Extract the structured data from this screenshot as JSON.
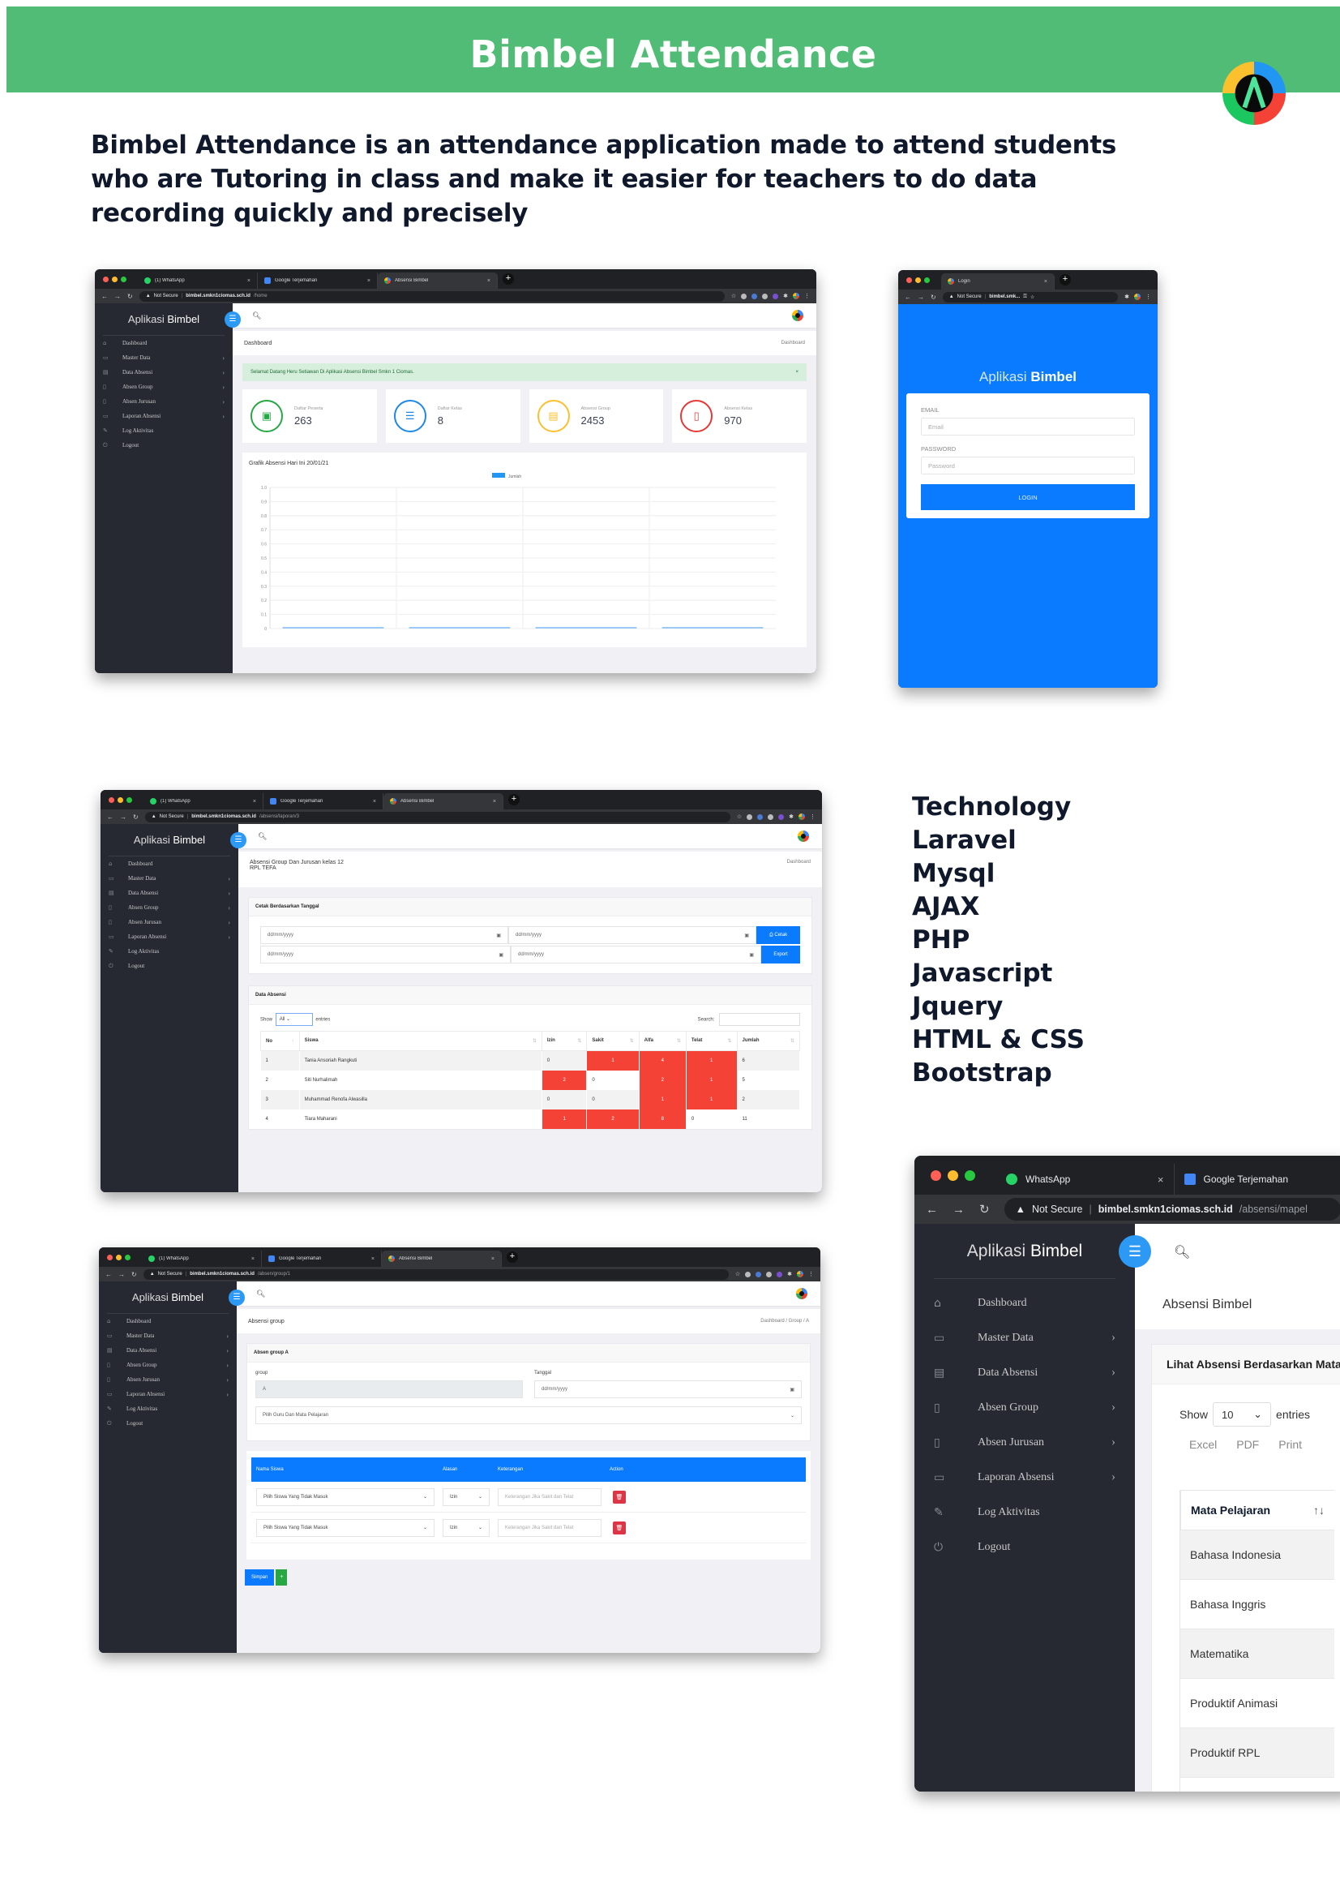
{
  "banner": {
    "title": "Bimbel Attendance"
  },
  "intro": "Bimbel Attendance is an attendance application made to attend students who are Tutoring in class and make it easier for teachers to do data recording quickly and precisely",
  "technology": {
    "heading": "Technology",
    "items": [
      "Laravel",
      "Mysql",
      "AJAX",
      "PHP",
      "Javascript",
      "Jquery",
      "HTML & CSS",
      "Bootstrap"
    ]
  },
  "colors": {
    "banner": "#50bc75",
    "primary": "#0a7bff",
    "danger": "#f44336",
    "sidebar": "#262932"
  },
  "browser": {
    "tabs": [
      "(1) WhatsApp",
      "Google Terjemahan",
      "Absensi Bimbel"
    ],
    "not_secure": "Not Secure",
    "host": "bimbel.smkn1ciomas.sch.id"
  },
  "app": {
    "brand_light": "Aplikasi",
    "brand_bold": "Bimbel",
    "sidebar": [
      {
        "label": "Dashboard",
        "icon": "home-icon",
        "glyph": "⌂",
        "chev": false
      },
      {
        "label": "Master Data",
        "icon": "layout-icon",
        "glyph": "▭",
        "chev": true
      },
      {
        "label": "Data Absensi",
        "icon": "calendar-icon",
        "glyph": "▤",
        "chev": true
      },
      {
        "label": "Absen Group",
        "icon": "notebook-icon",
        "glyph": "▯",
        "chev": true
      },
      {
        "label": "Absen Jurusan",
        "icon": "document-icon",
        "glyph": "▯",
        "chev": true
      },
      {
        "label": "Laporan Absensi",
        "icon": "folder-icon",
        "glyph": "▭",
        "chev": true
      },
      {
        "label": "Log Aktivitas",
        "icon": "edit-icon",
        "glyph": "✎",
        "chev": false
      },
      {
        "label": "Logout",
        "icon": "power-icon",
        "glyph": "⏻",
        "chev": false
      }
    ]
  },
  "dashboard": {
    "url_path": "/home",
    "page_title": "Dashboard",
    "breadcrumb": "Dashboard",
    "alert": "Selamat Datang Heru Setiawan Di Aplikasi Absensi Bimbel Smkn 1 Ciomas.",
    "alert_close": "×",
    "stats": [
      {
        "label": "Daftar Peserta",
        "value": "263",
        "color": "#28a745",
        "glyph": "▣"
      },
      {
        "label": "Daftar Kelas",
        "value": "8",
        "color": "#1e88e5",
        "glyph": "☰"
      },
      {
        "label": "Absensi Group",
        "value": "2453",
        "color": "#fbc02d",
        "glyph": "▤"
      },
      {
        "label": "Absensi Kelas",
        "value": "970",
        "color": "#e53935",
        "glyph": "▯"
      }
    ],
    "chart_title": "Grafik Absensi Hari Ini 20/01/21"
  },
  "chart_data": {
    "type": "bar",
    "title": "Grafik Absensi Hari Ini 20/01/21",
    "legend": [
      "Jumlah"
    ],
    "legend_position": "top",
    "categories": [
      "",
      "",
      "",
      ""
    ],
    "series": [
      {
        "name": "Jumlah",
        "values": [
          0,
          0,
          0,
          0
        ]
      }
    ],
    "yticks": [
      "0",
      "0.1",
      "0.2",
      "0.3",
      "0.4",
      "0.5",
      "0.6",
      "0.7",
      "0.8",
      "0.9",
      "1.0"
    ],
    "ylim": [
      0,
      1.0
    ],
    "grid": true
  },
  "login": {
    "tab": "Login",
    "url": "bimbel.smk...",
    "email_label": "EMAIL",
    "email_placeholder": "Email",
    "password_label": "PASSWORD",
    "password_placeholder": "Password",
    "button": "LOGIN"
  },
  "laporan": {
    "url_path": "/absensi/laporan/3",
    "page_title_line1": "Absensi Group Dan Jurusan kelas 12",
    "page_title_line2": "RPL TEFA",
    "breadcrumb": "Dashboard",
    "print_card_title": "Cetak Berdasarkan Tanggal",
    "date_placeholder": "dd/mm/yyyy",
    "cetak_button": "⎙ Cetak",
    "export_button": "Export",
    "data_card_title": "Data Absensi",
    "show_label": "Show",
    "show_value": "All",
    "entries_label": "entries",
    "search_label": "Search:",
    "columns": [
      "No",
      "Siswa",
      "Izin",
      "Sakit",
      "Alfa",
      "Telat",
      "Jumlah"
    ],
    "rows": [
      {
        "no": "1",
        "siswa": "Tania Ansoriah Rangkuti",
        "izin": "0",
        "sakit": "1",
        "alfa": "4",
        "telat": "1",
        "jumlah": "6"
      },
      {
        "no": "2",
        "siswa": "Siti Nurhalimah",
        "izin": "2",
        "sakit": "0",
        "alfa": "2",
        "telat": "1",
        "jumlah": "5"
      },
      {
        "no": "3",
        "siswa": "Muhammad Renofa Alwasilla",
        "izin": "0",
        "sakit": "0",
        "alfa": "1",
        "telat": "1",
        "jumlah": "2"
      },
      {
        "no": "4",
        "siswa": "Tiara Maharani",
        "izin": "1",
        "sakit": "2",
        "alfa": "8",
        "telat": "0",
        "jumlah": "11"
      }
    ]
  },
  "group": {
    "url_path": "/absen/group/1",
    "page_title": "Absensi group",
    "breadcrumb": "Dashboard / Group / A",
    "card_title": "Absen group A",
    "group_label": "group",
    "group_value": "A",
    "tanggal_label": "Tanggal",
    "tanggal_placeholder": "dd/mm/yyyy",
    "guru_select": "Pilih Guru Dan Mata Pelajaran",
    "columns": [
      "Nama Siswa",
      "Alasan",
      "Keterangan",
      "Action"
    ],
    "rows": [
      {
        "siswa": "Pilih Siswa Yang Tidak Masuk",
        "alasan": "Izin",
        "keterangan_placeholder": "Keterangan Jika Sakit dan Telat"
      },
      {
        "siswa": "Pilih Siswa Yang Tidak Masuk",
        "alasan": "Izin",
        "keterangan_placeholder": "Keterangan Jika Sakit dan Telat"
      }
    ],
    "save_button": "Simpan",
    "add_button": "+"
  },
  "mapel": {
    "tabs": [
      "WhatsApp",
      "Google Terjemahan"
    ],
    "url_path": "/absensi/mapel",
    "page_title": "Absensi Bimbel",
    "card_title": "Lihat Absensi Berdasarkan Mata Pelajaran",
    "show_label": "Show",
    "show_value": "10",
    "entries_label": "entries",
    "exports": [
      "Excel",
      "PDF",
      "Print"
    ],
    "column": "Mata Pelajaran",
    "rows": [
      "Bahasa Indonesia",
      "Bahasa Inggris",
      "Matematika",
      "Produktif Animasi",
      "Produktif RPL"
    ]
  }
}
